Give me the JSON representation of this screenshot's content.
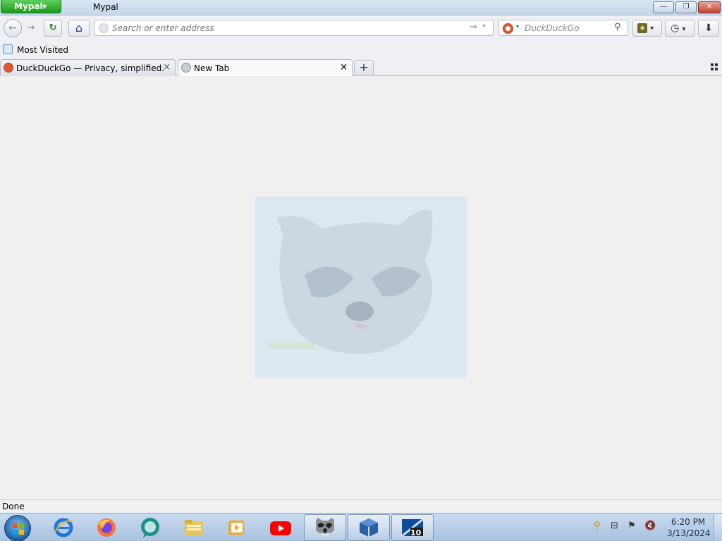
{
  "window": {
    "app_button_label": "Mypal",
    "title": "Mypal",
    "minimize_symbol": "—",
    "maximize_symbol": "❐",
    "close_symbol": "✕"
  },
  "navbar": {
    "back_symbol": "←",
    "forward_symbol": "→",
    "reload_symbol": "↻",
    "home_symbol": "⌂",
    "url_placeholder": "Search or enter address",
    "url_value": "",
    "go_symbol": "→",
    "url_dropdown_symbol": "▾",
    "search_placeholder": "DuckDuckGo",
    "search_engine_dropdown_symbol": "▾",
    "search_symbol": "⚲",
    "bookmarks_symbol": "★",
    "history_symbol": "◷",
    "downloads_symbol": "⬇",
    "dropdown_symbol": "▾"
  },
  "bookmarks_bar": {
    "items": [
      {
        "label": "Most Visited",
        "icon": "most-visited-icon"
      }
    ]
  },
  "tabs": [
    {
      "label": "DuckDuckGo — Privacy, simplified.",
      "icon": "duckduckgo-icon",
      "active": false,
      "close_symbol": "×"
    },
    {
      "label": "New Tab",
      "icon": "globe-icon",
      "active": true,
      "close_symbol": "×"
    }
  ],
  "new_tab_symbol": "+",
  "status_bar": {
    "text": "Done"
  },
  "taskbar": {
    "apps": [
      {
        "name": "internet-explorer-icon"
      },
      {
        "name": "firefox-icon"
      },
      {
        "name": "chat-app-icon"
      },
      {
        "name": "file-explorer-icon"
      },
      {
        "name": "media-player-icon"
      },
      {
        "name": "youtube-icon"
      },
      {
        "name": "mypal-raccoon-icon",
        "active": true
      },
      {
        "name": "virtualbox-icon",
        "active": true
      },
      {
        "name": "windows-10-app-icon",
        "active": true
      }
    ],
    "windows10_badge": "10",
    "clock_time": "6:20 PM",
    "clock_date": "3/13/2024"
  },
  "colors": {
    "app_button": "#1b9c1b",
    "close_button": "#c6412e",
    "duckduckgo": "#de5833",
    "youtube": "#ff0000"
  }
}
